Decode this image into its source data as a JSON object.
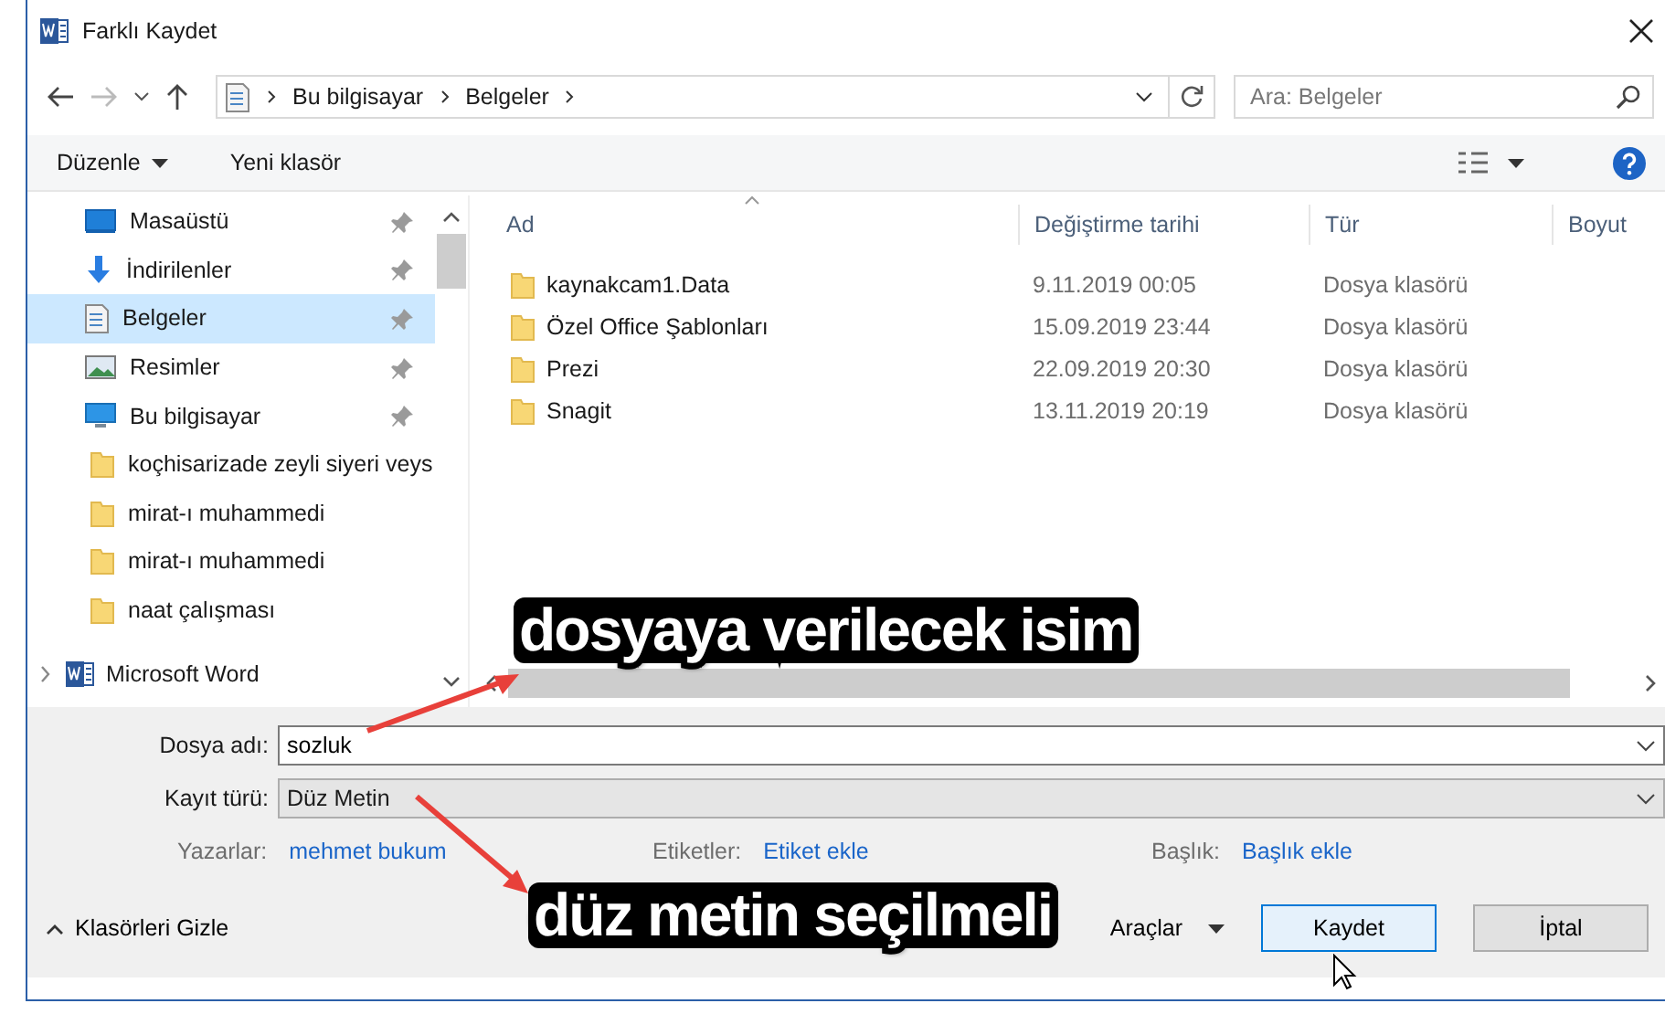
{
  "window": {
    "title": "Farklı Kaydet"
  },
  "address": {
    "crumbs": [
      "Bu bilgisayar",
      "Belgeler"
    ]
  },
  "search": {
    "placeholder": "Ara: Belgeler"
  },
  "toolbar": {
    "organize": "Düzenle",
    "new_folder": "Yeni klasör"
  },
  "sidebar": {
    "items": [
      {
        "label": "Masaüstü",
        "kind": "desktop",
        "pinned": true,
        "selected": false
      },
      {
        "label": "İndirilenler",
        "kind": "download",
        "pinned": true,
        "selected": false
      },
      {
        "label": "Belgeler",
        "kind": "document",
        "pinned": true,
        "selected": true
      },
      {
        "label": "Resimler",
        "kind": "pictures",
        "pinned": true,
        "selected": false
      },
      {
        "label": "Bu bilgisayar",
        "kind": "computer",
        "pinned": true,
        "selected": false
      },
      {
        "label": "koçhisarizade zeyli siyeri veys",
        "kind": "folder",
        "pinned": false,
        "selected": false
      },
      {
        "label": "mirat-ı muhammedi",
        "kind": "folder",
        "pinned": false,
        "selected": false
      },
      {
        "label": "mirat-ı muhammedi",
        "kind": "folder",
        "pinned": false,
        "selected": false
      },
      {
        "label": "naat çalışması",
        "kind": "folder",
        "pinned": false,
        "selected": false
      },
      {
        "label": "Microsoft Word",
        "kind": "word",
        "pinned": false,
        "selected": false,
        "expanded": false
      }
    ]
  },
  "table": {
    "columns": [
      "Ad",
      "Değiştirme tarihi",
      "Tür",
      "Boyut"
    ],
    "rows": [
      {
        "name": "kaynakcam1.Data",
        "modified": "9.11.2019 00:05",
        "type": "Dosya klasörü"
      },
      {
        "name": "Özel Office Şablonları",
        "modified": "15.09.2019 23:44",
        "type": "Dosya klasörü"
      },
      {
        "name": "Prezi",
        "modified": "22.09.2019 20:30",
        "type": "Dosya klasörü"
      },
      {
        "name": "Snagit",
        "modified": "13.11.2019 20:19",
        "type": "Dosya klasörü"
      }
    ]
  },
  "form": {
    "file_name": {
      "label": "Dosya adı:",
      "value": "sozluk"
    },
    "save_type": {
      "label": "Kayıt türü:",
      "value": "Düz Metin"
    },
    "meta": [
      {
        "label": "Yazarlar:",
        "value": "mehmet bukum"
      },
      {
        "label": "Etiketler:",
        "value": "Etiket ekle"
      },
      {
        "label": "Başlık:",
        "value": "Başlık ekle"
      }
    ]
  },
  "footer": {
    "hide_folders": "Klasörleri Gizle",
    "tools": "Araçlar",
    "buttons": [
      {
        "label": "Kaydet",
        "default": true
      },
      {
        "label": "İptal",
        "default": false
      }
    ]
  },
  "annotations": [
    {
      "text": "dosyaya verilecek isim"
    },
    {
      "text": "düz metin seçilmeli"
    }
  ]
}
